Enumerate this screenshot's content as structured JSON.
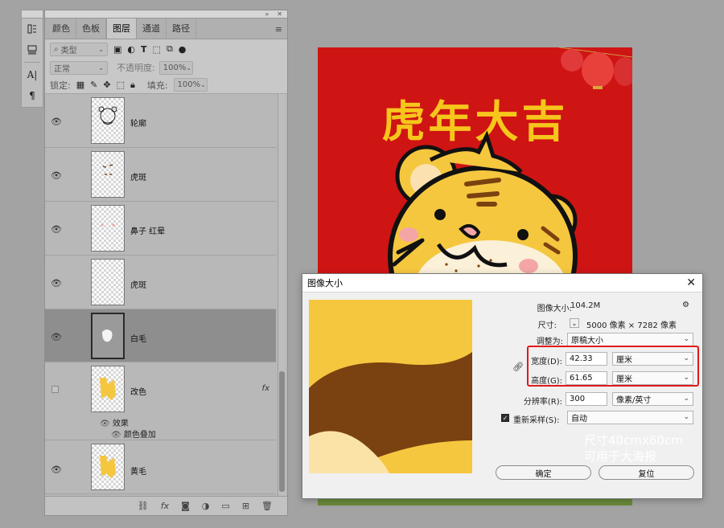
{
  "panel": {
    "tabs": [
      "颜色",
      "色板",
      "图层",
      "通道",
      "路径"
    ],
    "active_tab": "图层",
    "menu_icon": "≡",
    "filter_kind": "类型",
    "blend_mode": "正常",
    "opacity_label": "不透明度:",
    "opacity_value": "100%",
    "lock_label": "锁定:",
    "fill_label": "填充:",
    "fill_value": "100%",
    "layers": [
      {
        "name": "轮廓",
        "visible": true
      },
      {
        "name": "虎斑",
        "visible": true
      },
      {
        "name": "鼻子 红晕",
        "visible": true
      },
      {
        "name": "虎斑",
        "visible": true
      },
      {
        "name": "白毛",
        "visible": true,
        "selected": true
      },
      {
        "name": "改色",
        "visible": false,
        "fx": "fx"
      },
      {
        "name": "黄毛",
        "visible": true
      }
    ],
    "effects_label": "效果",
    "effect_item": "颜色叠加"
  },
  "poster": {
    "title": "虎年大吉"
  },
  "dialog": {
    "title": "图像大小",
    "image_size_label": "图像大小:",
    "image_size_value": "104.2M",
    "dimensions_label": "尺寸:",
    "dimensions_value": "5000 像素 × 7282 像素",
    "fit_to_label": "调整为:",
    "fit_to_value": "原稿大小",
    "width_label": "宽度(D):",
    "width_value": "42.33",
    "width_unit": "厘米",
    "height_label": "高度(G):",
    "height_value": "61.65",
    "height_unit": "厘米",
    "resolution_label": "分辨率(R):",
    "resolution_value": "300",
    "resolution_unit": "像素/英寸",
    "resample_label": "重新采样(S):",
    "resample_value": "自动",
    "ok_button": "确定",
    "reset_button": "复位",
    "note_line1": "尺寸40cmx60cm",
    "note_line2": "可用于大海报"
  },
  "colors": {
    "poster_red": "#cf1414",
    "title_yellow": "#f6c61c",
    "tiger_yellow": "#f5c73f",
    "tiger_brown": "#7a4210",
    "highlight_red": "#e01a1a"
  }
}
